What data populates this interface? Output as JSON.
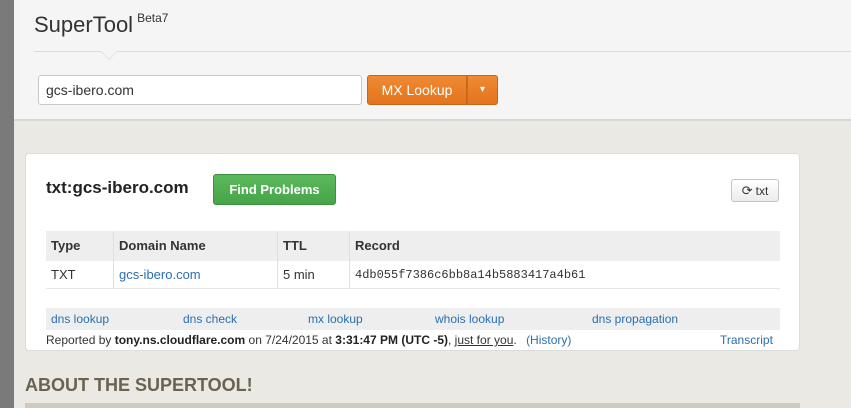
{
  "header": {
    "app_name": "SuperTool",
    "version": "Beta7"
  },
  "search": {
    "value": "gcs-ibero.com",
    "button_label": "MX Lookup",
    "caret": "▾"
  },
  "result": {
    "title": "txt:gcs-ibero.com",
    "find_problems_label": "Find Problems",
    "refresh_label": "txt",
    "refresh_icon": "refresh-icon",
    "columns": [
      "Type",
      "Domain Name",
      "TTL",
      "Record"
    ],
    "rows": [
      {
        "type": "TXT",
        "domain": "gcs-ibero.com",
        "ttl": "5 min",
        "record": "4db055f7386c6bb8a14b5883417a4b61"
      }
    ],
    "links": [
      "dns lookup",
      "dns check",
      "mx lookup",
      "whois lookup",
      "dns propagation"
    ],
    "reported": {
      "prefix": "Reported by",
      "server": "tony.ns.cloudflare.com",
      "on": "on 7/24/2015 at",
      "time": "3:31:47 PM (UTC -5)",
      "sep": ",",
      "for_you": "just for you",
      "period": ".",
      "history": "(History)"
    },
    "transcript_label": "Transcript"
  },
  "about": {
    "heading": "ABOUT THE SUPERTOOL!"
  },
  "colors": {
    "accent_orange": "#e97d26",
    "success_green": "#52b052",
    "link_blue": "#2a6fb0"
  }
}
